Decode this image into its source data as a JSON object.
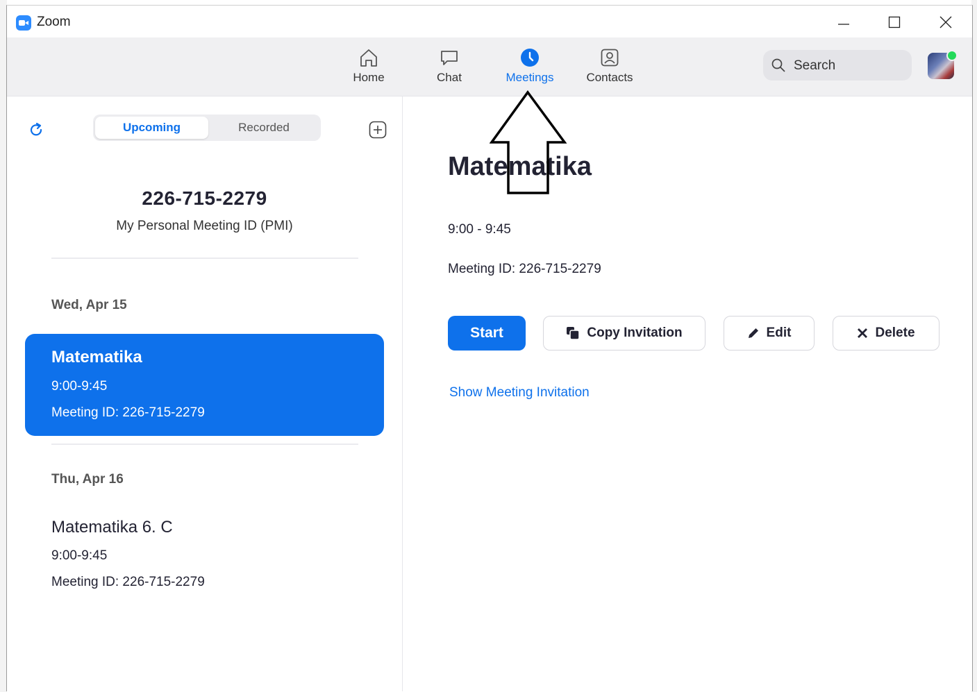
{
  "window": {
    "title": "Zoom"
  },
  "nav": {
    "tabs": [
      {
        "label": "Home",
        "icon": "home-icon",
        "active": false
      },
      {
        "label": "Chat",
        "icon": "chat-icon",
        "active": false
      },
      {
        "label": "Meetings",
        "icon": "clock-icon",
        "active": true
      },
      {
        "label": "Contacts",
        "icon": "contacts-icon",
        "active": false
      }
    ],
    "search_placeholder": "Search"
  },
  "sidebar": {
    "segments": {
      "upcoming": "Upcoming",
      "recorded": "Recorded"
    },
    "pmi": {
      "number": "226-715-2279",
      "label": "My Personal Meeting ID (PMI)"
    },
    "groups": [
      {
        "date": "Wed, Apr 15",
        "meetings": [
          {
            "title": "Matematika",
            "time": "9:00-9:45",
            "meeting_id": "Meeting ID: 226-715-2279",
            "selected": true
          }
        ]
      },
      {
        "date": "Thu, Apr 16",
        "meetings": [
          {
            "title": "Matematika 6. C",
            "time": "9:00-9:45",
            "meeting_id": "Meeting ID: 226-715-2279",
            "selected": false
          }
        ]
      }
    ]
  },
  "detail": {
    "title": "Matematika",
    "time": "9:00 - 9:45",
    "meeting_id": "Meeting ID: 226-715-2279",
    "buttons": {
      "start": "Start",
      "copy_invitation": "Copy Invitation",
      "edit": "Edit",
      "delete": "Delete"
    },
    "show_invitation": "Show Meeting Invitation"
  },
  "colors": {
    "accent": "#0e71eb",
    "nav_bg": "#f0f0f2",
    "presence": "#23d959"
  }
}
